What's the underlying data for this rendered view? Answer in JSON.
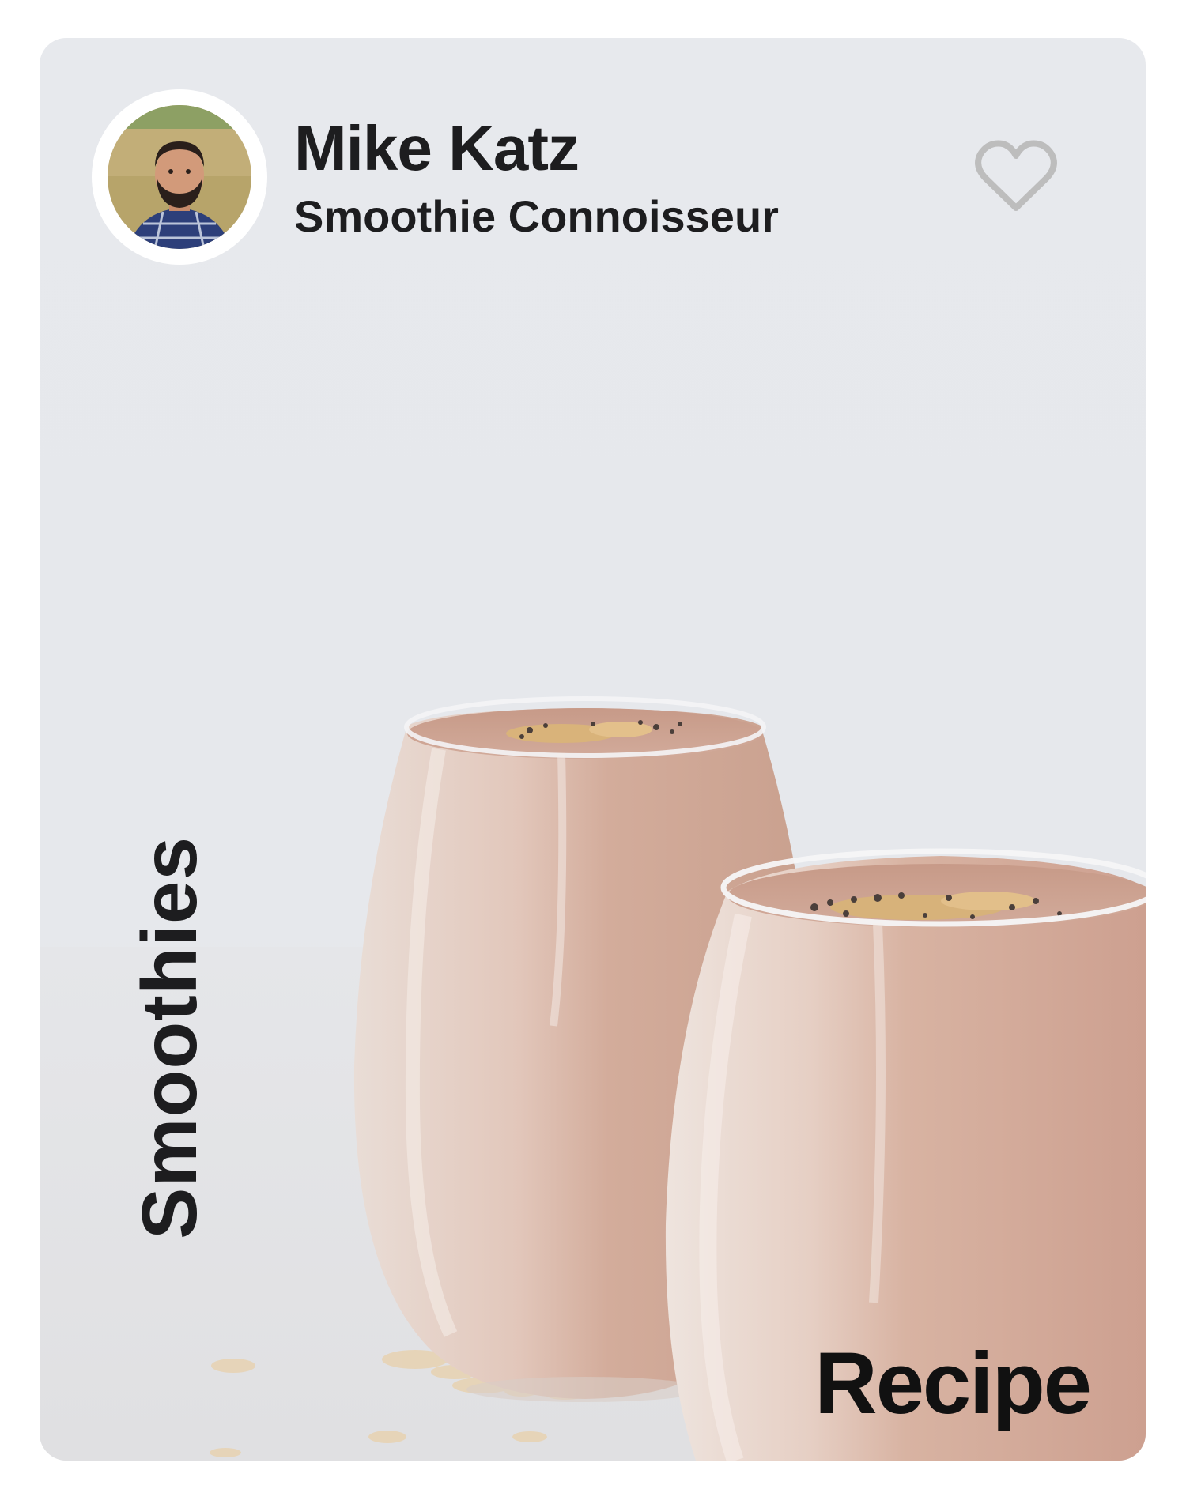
{
  "card": {
    "author": {
      "name": "Mike Katz",
      "role": "Smoothie Connoisseur"
    },
    "favorite": {
      "icon": "heart-outline-icon",
      "state": "not-favorited",
      "color": "#bdbdbd"
    },
    "category_label": "Smoothies",
    "type_label": "Recipe"
  }
}
